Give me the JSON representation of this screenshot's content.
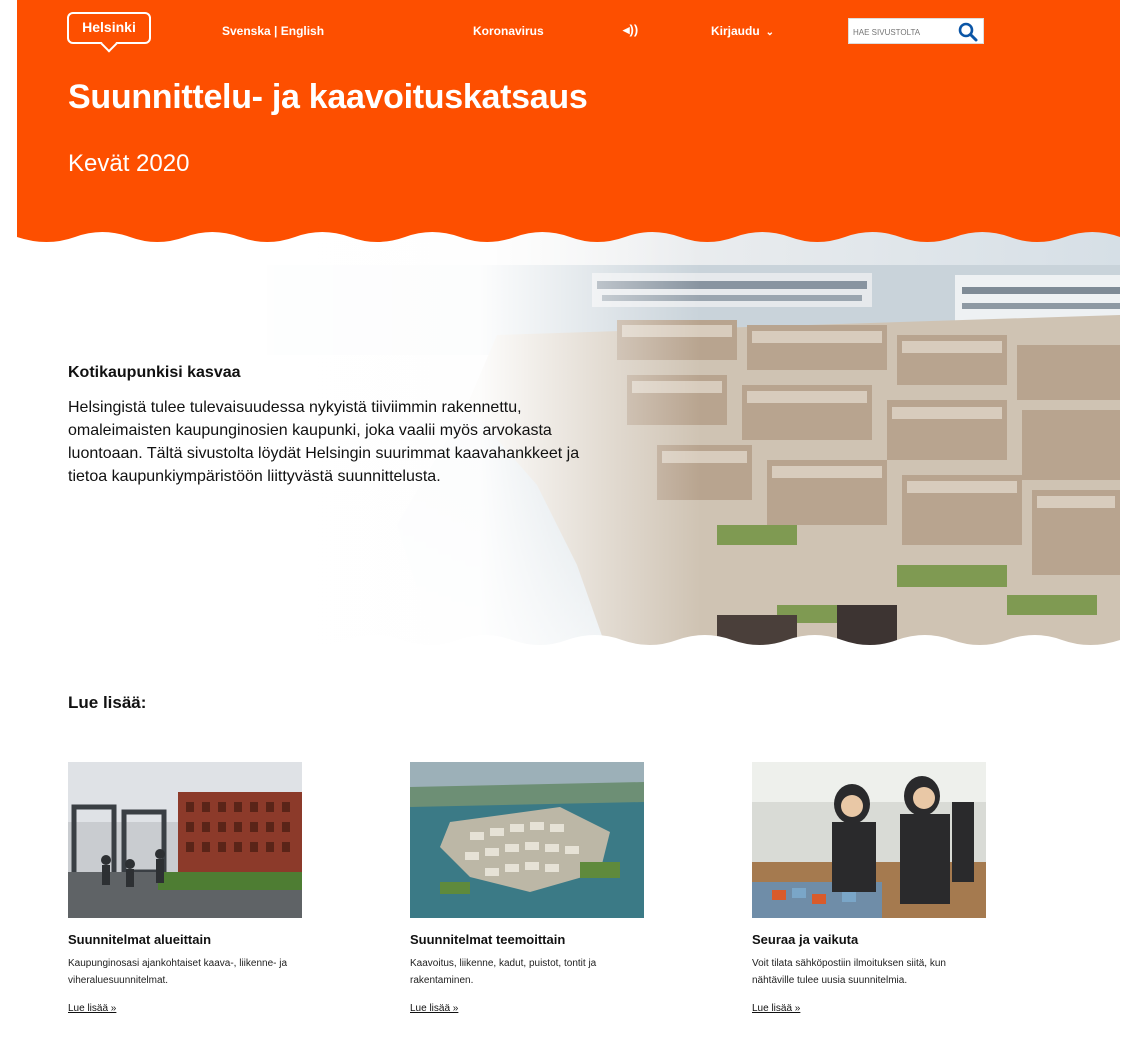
{
  "header": {
    "logo": "Helsinki",
    "languages": "Svenska | English",
    "coronavirus": "Koronavirus",
    "speaker_glyph": "◂))",
    "login": "Kirjaudu",
    "search_placeholder": "HAE SIVUSTOLTA",
    "brand_color": "#fd4f00"
  },
  "hero": {
    "title": "Suunnittelu- ja kaavoituskatsaus",
    "subtitle": "Kevät 2020",
    "heading": "Kotikaupunkisi kasvaa",
    "body": "Helsingistä tulee tulevaisuudessa nykyistä tiiviimmin rakennettu, omaleimaisten kaupunginosien kaupunki, joka vaalii myös arvokasta luontoaan. Tältä sivustolta löydät Helsingin suurimmat kaavahankkeet ja tietoa kaupunkiympäristöön liittyvästä suunnittelusta."
  },
  "readmore": {
    "title": "Lue lisää:",
    "cards": [
      {
        "title": "Suunnitelmat alueittain",
        "desc": "Kaupunginosasi ajankohtaiset kaava-, liikenne- ja viheraluesuunnitelmat.",
        "link": "Lue lisää »"
      },
      {
        "title": "Suunnitelmat teemoittain",
        "desc": "Kaavoitus, liikenne, kadut, puistot, tontit ja rakentaminen.",
        "link": "Lue lisää »"
      },
      {
        "title": "Seuraa ja vaikuta",
        "desc": "Voit tilata sähköpostiin ilmoituksen siitä, kun nähtäville tulee uusia suunnitelmia.",
        "link": "Lue lisää »"
      }
    ]
  }
}
